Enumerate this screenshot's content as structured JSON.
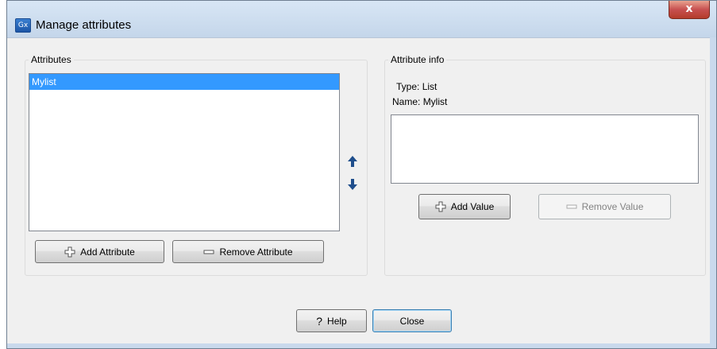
{
  "window": {
    "title": "Manage attributes",
    "app_icon_text": "Gx",
    "close_glyph": "x"
  },
  "attributes_group": {
    "title": "Attributes",
    "items": [
      {
        "label": "Mylist",
        "selected": true
      }
    ],
    "add_button": "Add Attribute",
    "remove_button": "Remove Attribute"
  },
  "order_controls": {
    "up_icon": "arrow-up-icon",
    "down_icon": "arrow-down-icon"
  },
  "info_group": {
    "title": "Attribute info",
    "type_label": "Type:",
    "type_value": "List",
    "name_label": "Name:",
    "name_value": "Mylist",
    "add_value_button": "Add Value",
    "remove_value_button": "Remove Value"
  },
  "footer": {
    "help_glyph": "?",
    "help_button": "Help",
    "close_button": "Close"
  },
  "colors": {
    "selection": "#3399ff",
    "arrow": "#1f4e8c",
    "default_button_border": "#3c7fb1"
  }
}
